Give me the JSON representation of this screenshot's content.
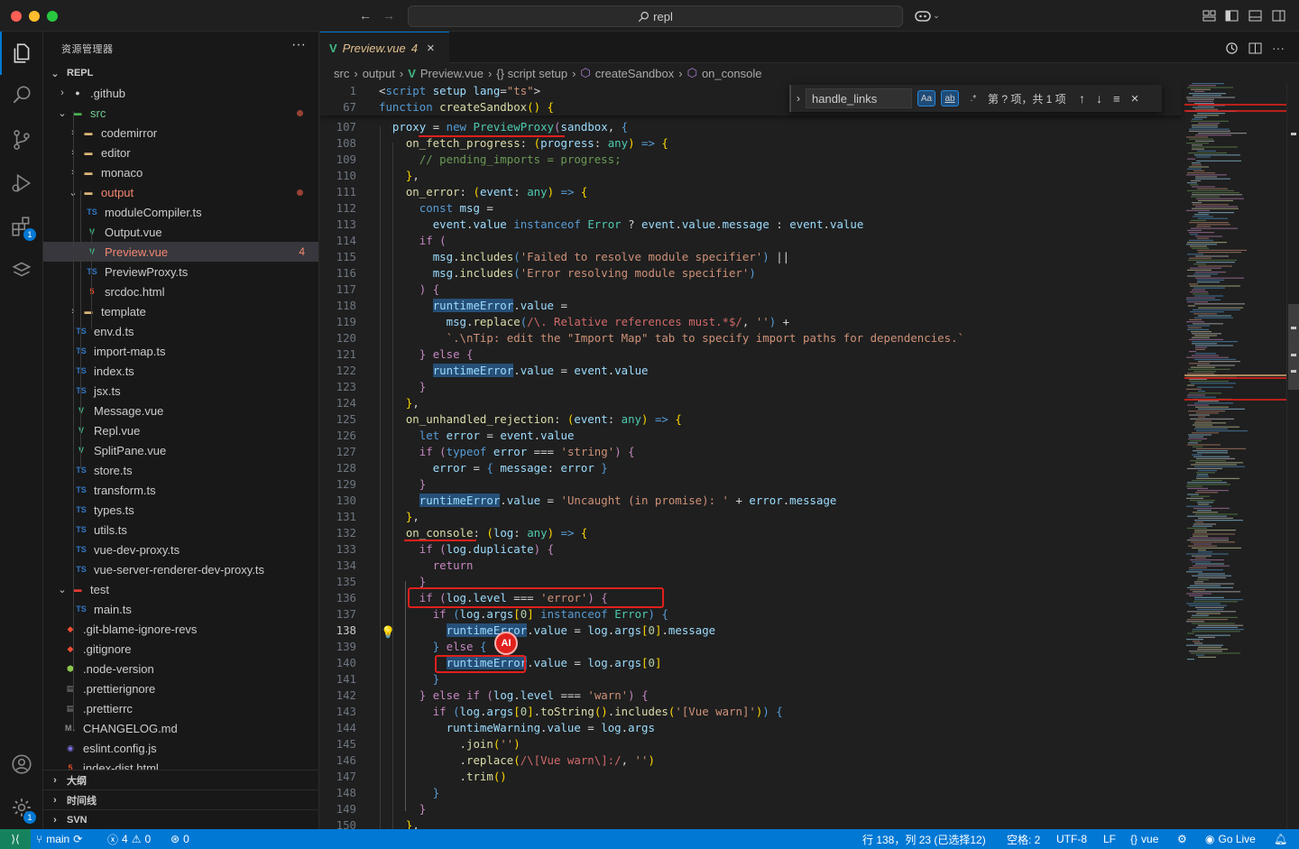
{
  "window": {
    "search_text": "repl"
  },
  "activity": {
    "extensions_badge": "1",
    "settings_badge": "1"
  },
  "explorer": {
    "title": "资源管理器",
    "root": "REPL",
    "tree": [
      {
        "label": ".github",
        "level": 1,
        "type": "folder",
        "open": false,
        "icon": "github-folder-icon"
      },
      {
        "label": "src",
        "level": 1,
        "type": "folder",
        "open": true,
        "icon": "src-folder-icon",
        "dot": true
      },
      {
        "label": "codemirror",
        "level": 2,
        "type": "folder",
        "open": false,
        "icon": "folder-icon"
      },
      {
        "label": "editor",
        "level": 2,
        "type": "folder",
        "open": false,
        "icon": "folder-icon"
      },
      {
        "label": "monaco",
        "level": 2,
        "type": "folder",
        "open": false,
        "icon": "folder-icon"
      },
      {
        "label": "output",
        "level": 2,
        "type": "folder",
        "open": true,
        "icon": "folder-open-icon",
        "dot": true
      },
      {
        "label": "moduleCompiler.ts",
        "level": 3,
        "type": "ts",
        "icon": "ts-icon"
      },
      {
        "label": "Output.vue",
        "level": 3,
        "type": "vue",
        "icon": "vue-icon"
      },
      {
        "label": "Preview.vue",
        "level": 3,
        "type": "vue",
        "icon": "vue-icon",
        "selected": true,
        "badge": "4"
      },
      {
        "label": "PreviewProxy.ts",
        "level": 3,
        "type": "ts",
        "icon": "ts-icon"
      },
      {
        "label": "srcdoc.html",
        "level": 3,
        "type": "html",
        "icon": "html-icon"
      },
      {
        "label": "template",
        "level": 2,
        "type": "folder",
        "open": false,
        "icon": "folder-icon"
      },
      {
        "label": "env.d.ts",
        "level": 2,
        "type": "ts",
        "icon": "ts-icon"
      },
      {
        "label": "import-map.ts",
        "level": 2,
        "type": "ts",
        "icon": "ts-icon"
      },
      {
        "label": "index.ts",
        "level": 2,
        "type": "ts",
        "icon": "ts-icon"
      },
      {
        "label": "jsx.ts",
        "level": 2,
        "type": "ts",
        "icon": "ts-icon"
      },
      {
        "label": "Message.vue",
        "level": 2,
        "type": "vue",
        "icon": "vue-icon"
      },
      {
        "label": "Repl.vue",
        "level": 2,
        "type": "vue",
        "icon": "vue-icon"
      },
      {
        "label": "SplitPane.vue",
        "level": 2,
        "type": "vue",
        "icon": "vue-icon"
      },
      {
        "label": "store.ts",
        "level": 2,
        "type": "ts",
        "icon": "ts-icon"
      },
      {
        "label": "transform.ts",
        "level": 2,
        "type": "ts",
        "icon": "ts-icon"
      },
      {
        "label": "types.ts",
        "level": 2,
        "type": "ts",
        "icon": "ts-icon"
      },
      {
        "label": "utils.ts",
        "level": 2,
        "type": "ts",
        "icon": "ts-icon"
      },
      {
        "label": "vue-dev-proxy.ts",
        "level": 2,
        "type": "ts",
        "icon": "ts-icon"
      },
      {
        "label": "vue-server-renderer-dev-proxy.ts",
        "level": 2,
        "type": "ts",
        "icon": "ts-icon"
      },
      {
        "label": "test",
        "level": 1,
        "type": "folder",
        "open": true,
        "icon": "test-folder-icon"
      },
      {
        "label": "main.ts",
        "level": 2,
        "type": "ts",
        "icon": "ts-icon"
      },
      {
        "label": ".git-blame-ignore-revs",
        "level": 1,
        "type": "git",
        "icon": "git-icon"
      },
      {
        "label": ".gitignore",
        "level": 1,
        "type": "git",
        "icon": "git-icon"
      },
      {
        "label": ".node-version",
        "level": 1,
        "type": "node",
        "icon": "node-icon"
      },
      {
        "label": ".prettierignore",
        "level": 1,
        "type": "file",
        "icon": "prettier-icon"
      },
      {
        "label": ".prettierrc",
        "level": 1,
        "type": "file",
        "icon": "prettier-icon"
      },
      {
        "label": "CHANGELOG.md",
        "level": 1,
        "type": "md",
        "icon": "markdown-icon"
      },
      {
        "label": "eslint.config.js",
        "level": 1,
        "type": "eslint",
        "icon": "eslint-icon"
      },
      {
        "label": "index-dist.html",
        "level": 1,
        "type": "html",
        "icon": "html-icon"
      }
    ],
    "sections": [
      "大纲",
      "时间线",
      "SVN"
    ]
  },
  "tab": {
    "label": "Preview.vue",
    "count": "4"
  },
  "breadcrumb": [
    "src",
    "output",
    "Preview.vue",
    "{} script setup",
    "createSandbox",
    "on_console"
  ],
  "find": {
    "query": "handle_links",
    "case_label": "Aa",
    "word_label": "ab",
    "regex_label": ".*",
    "result": "第 ? 项，共 1 项"
  },
  "code_lines": [
    {
      "n": "1",
      "html": "<span class='p'>&lt;</span><span class='k'>script</span> <span class='v'>setup</span> <span class='v'>lang</span><span class='p'>=</span><span class='s'>\"ts\"</span><span class='p'>&gt;</span>",
      "sticky": true
    },
    {
      "n": "67",
      "html": "<span class='k'>function</span> <span class='f'>createSandbox</span><span class='b'>()</span> <span class='b'>{</span>",
      "sticky": true
    },
    {
      "n": "107",
      "html": "  <span class='v'>proxy</span> <span class='p'>=</span> <span class='k'>new</span> <span class='t'>PreviewProxy</span><span class='c'>(</span><span class='v'>sandbox</span><span class='p'>,</span> <span class='k'>{</span>"
    },
    {
      "n": "108",
      "html": "    <span class='f'>on_fetch_progress</span><span class='p'>:</span> <span class='b'>(</span><span class='v'>progress</span><span class='p'>:</span> <span class='t'>any</span><span class='b'>)</span> <span class='k'>=&gt;</span> <span class='b'>{</span>"
    },
    {
      "n": "109",
      "html": "      <span class='cm'>// pending_imports = progress;</span>"
    },
    {
      "n": "110",
      "html": "    <span class='b'>}</span><span class='p'>,</span>"
    },
    {
      "n": "111",
      "html": "    <span class='f'>on_error</span><span class='p'>:</span> <span class='b'>(</span><span class='v'>event</span><span class='p'>:</span> <span class='t'>any</span><span class='b'>)</span> <span class='k'>=&gt;</span> <span class='b'>{</span>"
    },
    {
      "n": "112",
      "html": "      <span class='k'>const</span> <span class='v'>msg</span> <span class='p'>=</span>"
    },
    {
      "n": "113",
      "html": "        <span class='v'>event</span><span class='p'>.</span><span class='v'>value</span> <span class='k'>instanceof</span> <span class='t'>Error</span> <span class='p'>?</span> <span class='v'>event</span><span class='p'>.</span><span class='v'>value</span><span class='p'>.</span><span class='v'>message</span> <span class='p'>:</span> <span class='v'>event</span><span class='p'>.</span><span class='v'>value</span>"
    },
    {
      "n": "114",
      "html": "      <span class='c'>if</span> <span class='c'>(</span>"
    },
    {
      "n": "115",
      "html": "        <span class='v'>msg</span><span class='p'>.</span><span class='f'>includes</span><span class='k'>(</span><span class='s'>'Failed to resolve module specifier'</span><span class='k'>)</span> <span class='p'>||</span>"
    },
    {
      "n": "116",
      "html": "        <span class='v'>msg</span><span class='p'>.</span><span class='f'>includes</span><span class='k'>(</span><span class='s'>'Error resolving module specifier'</span><span class='k'>)</span>"
    },
    {
      "n": "117",
      "html": "      <span class='c'>)</span> <span class='c'>{</span>"
    },
    {
      "n": "118",
      "html": "        <span class='v hl'>runtimeError</span><span class='p'>.</span><span class='v'>value</span> <span class='p'>=</span>"
    },
    {
      "n": "119",
      "html": "          <span class='v'>msg</span><span class='p'>.</span><span class='f'>replace</span><span class='k'>(</span><span class='r'>/\\. Relative references must.*$/</span><span class='p'>,</span> <span class='s'>''</span><span class='k'>)</span> <span class='p'>+</span>"
    },
    {
      "n": "120",
      "html": "          <span class='s'>`.\\nTip: edit the \"Import Map\" tab to specify import paths for dependencies.`</span>"
    },
    {
      "n": "121",
      "html": "      <span class='c'>}</span> <span class='c'>else</span> <span class='c'>{</span>"
    },
    {
      "n": "122",
      "html": "        <span class='v hl'>runtimeError</span><span class='p'>.</span><span class='v'>value</span> <span class='p'>=</span> <span class='v'>event</span><span class='p'>.</span><span class='v'>value</span>"
    },
    {
      "n": "123",
      "html": "      <span class='c'>}</span>"
    },
    {
      "n": "124",
      "html": "    <span class='b'>}</span><span class='p'>,</span>"
    },
    {
      "n": "125",
      "html": "    <span class='f'>on_unhandled_rejection</span><span class='p'>:</span> <span class='b'>(</span><span class='v'>event</span><span class='p'>:</span> <span class='t'>any</span><span class='b'>)</span> <span class='k'>=&gt;</span> <span class='b'>{</span>"
    },
    {
      "n": "126",
      "html": "      <span class='k'>let</span> <span class='v'>error</span> <span class='p'>=</span> <span class='v'>event</span><span class='p'>.</span><span class='v'>value</span>"
    },
    {
      "n": "127",
      "html": "      <span class='c'>if</span> <span class='c'>(</span><span class='k'>typeof</span> <span class='v'>error</span> <span class='p'>===</span> <span class='s'>'string'</span><span class='c'>)</span> <span class='c'>{</span>"
    },
    {
      "n": "128",
      "html": "        <span class='v'>error</span> <span class='p'>=</span> <span class='k'>{</span> <span class='v'>message</span><span class='p'>:</span> <span class='v'>error</span> <span class='k'>}</span>"
    },
    {
      "n": "129",
      "html": "      <span class='c'>}</span>"
    },
    {
      "n": "130",
      "html": "      <span class='v hl'>runtimeError</span><span class='p'>.</span><span class='v'>value</span> <span class='p'>=</span> <span class='s'>'Uncaught (in promise): '</span> <span class='p'>+</span> <span class='v'>error</span><span class='p'>.</span><span class='v'>message</span>"
    },
    {
      "n": "131",
      "html": "    <span class='b'>}</span><span class='p'>,</span>"
    },
    {
      "n": "132",
      "html": "    <span class='f'>on_console</span><span class='p'>:</span> <span class='b'>(</span><span class='v'>log</span><span class='p'>:</span> <span class='t'>any</span><span class='b'>)</span> <span class='k'>=&gt;</span> <span class='b'>{</span>"
    },
    {
      "n": "133",
      "html": "      <span class='c'>if</span> <span class='c'>(</span><span class='v'>log</span><span class='p'>.</span><span class='v'>duplicate</span><span class='c'>)</span> <span class='c'>{</span>"
    },
    {
      "n": "134",
      "html": "        <span class='c'>return</span>"
    },
    {
      "n": "135",
      "html": "      <span class='c'>}</span>"
    },
    {
      "n": "136",
      "html": "      <span class='c'>if</span> <span class='c'>(</span><span class='v'>log</span><span class='p'>.</span><span class='v'>level</span> <span class='p'>===</span> <span class='s'>'error'</span><span class='c'>)</span> <span class='c'>{</span>"
    },
    {
      "n": "137",
      "html": "        <span class='c'>if</span> <span class='k'>(</span><span class='v'>log</span><span class='p'>.</span><span class='v'>args</span><span class='b'>[</span><span class='n'>0</span><span class='b'>]</span> <span class='k'>instanceof</span> <span class='t'>Error</span><span class='k'>)</span> <span class='k'>{</span>"
    },
    {
      "n": "138",
      "html": "          <span class='v hl'>runtimeError</span><span class='p'>.</span><span class='v'>value</span> <span class='p'>=</span> <span class='v'>log</span><span class='p'>.</span><span class='v'>args</span><span class='b'>[</span><span class='n'>0</span><span class='b'>]</span><span class='p'>.</span><span class='v'>message</span>",
      "cur": true
    },
    {
      "n": "139",
      "html": "        <span class='k'>}</span> <span class='c'>else</span> <span class='k'>{</span>"
    },
    {
      "n": "140",
      "html": "          <span class='v hl'>runtimeError</span><span class='p'>.</span><span class='v'>value</span> <span class='p'>=</span> <span class='v'>log</span><span class='p'>.</span><span class='v'>args</span><span class='b'>[</span><span class='n'>0</span><span class='b'>]</span>"
    },
    {
      "n": "141",
      "html": "        <span class='k'>}</span>"
    },
    {
      "n": "142",
      "html": "      <span class='c'>}</span> <span class='c'>else</span> <span class='c'>if</span> <span class='c'>(</span><span class='v'>log</span><span class='p'>.</span><span class='v'>level</span> <span class='p'>===</span> <span class='s'>'warn'</span><span class='c'>)</span> <span class='c'>{</span>"
    },
    {
      "n": "143",
      "html": "        <span class='c'>if</span> <span class='k'>(</span><span class='v'>log</span><span class='p'>.</span><span class='v'>args</span><span class='b'>[</span><span class='n'>0</span><span class='b'>]</span><span class='p'>.</span><span class='f'>toString</span><span class='b'>()</span><span class='p'>.</span><span class='f'>includes</span><span class='b'>(</span><span class='s'>'[Vue warn]'</span><span class='b'>)</span><span class='k'>)</span> <span class='k'>{</span>"
    },
    {
      "n": "144",
      "html": "          <span class='v'>runtimeWarning</span><span class='p'>.</span><span class='v'>value</span> <span class='p'>=</span> <span class='v'>log</span><span class='p'>.</span><span class='v'>args</span>"
    },
    {
      "n": "145",
      "html": "            <span class='p'>.</span><span class='f'>join</span><span class='b'>(</span><span class='s'>''</span><span class='b'>)</span>"
    },
    {
      "n": "146",
      "html": "            <span class='p'>.</span><span class='f'>replace</span><span class='b'>(</span><span class='r'>/\\[Vue warn\\]:/</span><span class='p'>,</span> <span class='s'>''</span><span class='b'>)</span>"
    },
    {
      "n": "147",
      "html": "            <span class='p'>.</span><span class='f'>trim</span><span class='b'>()</span>"
    },
    {
      "n": "148",
      "html": "        <span class='k'>}</span>"
    },
    {
      "n": "149",
      "html": "      <span class='c'>}</span>"
    },
    {
      "n": "150",
      "html": "    <span class='b'>}</span><span class='p'>,</span>"
    }
  ],
  "status": {
    "branch": "main",
    "errors": "4",
    "warnings": "0",
    "ports": "0",
    "position": "行 138，列 23 (已选择12)",
    "spaces": "空格: 2",
    "encoding": "UTF-8",
    "eol": "LF",
    "language": "vue",
    "golive": "Go Live"
  }
}
